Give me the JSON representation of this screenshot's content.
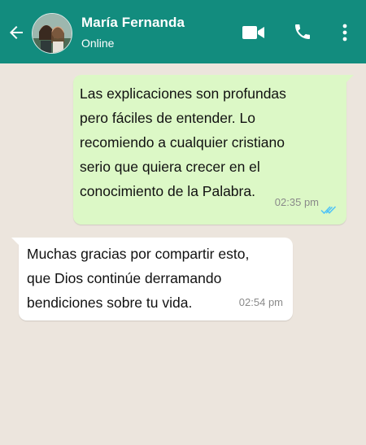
{
  "header": {
    "contact_name": "María Fernanda",
    "status": "Online",
    "background_color": "#128c7e",
    "icons": [
      "back-arrow-icon",
      "video-call-icon",
      "phone-icon",
      "more-options-icon"
    ]
  },
  "messages": [
    {
      "direction": "outgoing",
      "text": " Las explicaciones son profundas\npero fáciles de entender. Lo\nrecomiendo a cualquier cristiano\nserio que quiera crecer en el\nconocimiento de la Palabra.",
      "time": "02:35 pm",
      "read_icon": "double-check-icon",
      "bubble_color": "#dcf8c6"
    },
    {
      "direction": "incoming",
      "text": " Muchas gracias por compartir esto,\nque Dios continúe derramando\nbendiciones sobre tu vida.",
      "time": "02:54 pm",
      "bubble_color": "#ffffff"
    }
  ]
}
